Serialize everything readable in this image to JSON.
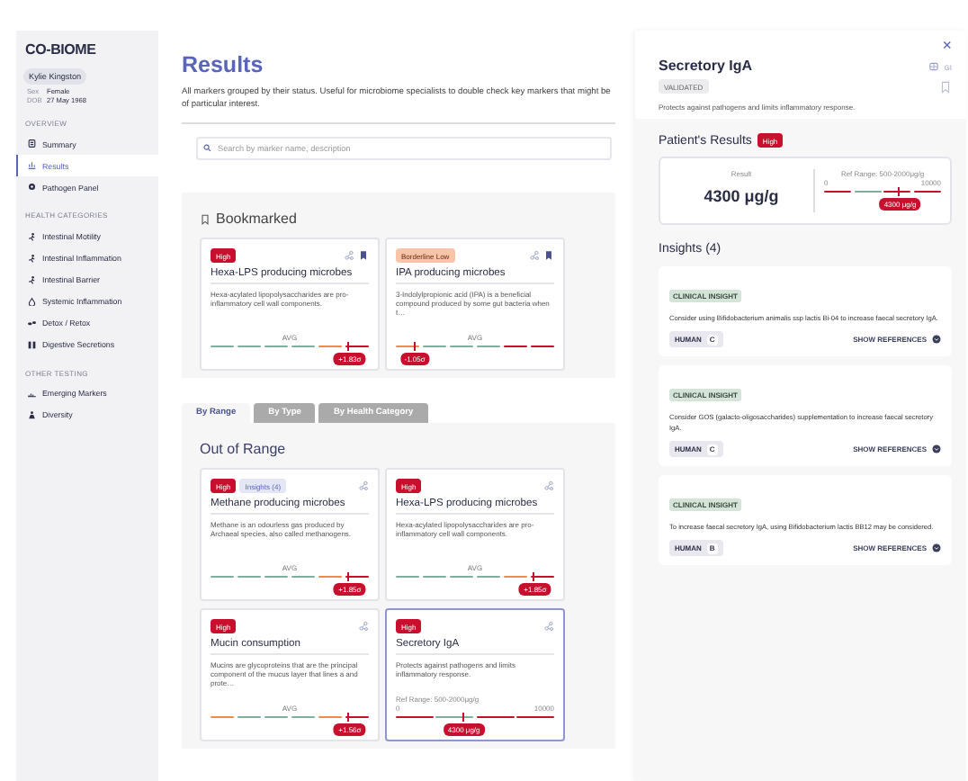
{
  "sidebar": {
    "logo": "CO-BIOME",
    "patient": {
      "name": "Kylie Kingston",
      "fields": [
        {
          "label": "Sex",
          "value": "Female"
        },
        {
          "label": "DOB",
          "value": "27 May 1968"
        }
      ]
    },
    "groups": [
      {
        "heading": "OVERVIEW",
        "items": [
          {
            "label": "Summary",
            "selected": false
          },
          {
            "label": "Results",
            "selected": true
          },
          {
            "label": "Pathogen Panel",
            "selected": false
          }
        ]
      },
      {
        "heading": "HEALTH CATEGORIES",
        "items": [
          {
            "label": "Intestinal Motility",
            "selected": false
          },
          {
            "label": "Intestinal Inflammation",
            "selected": false
          },
          {
            "label": "Intestinal Barrier",
            "selected": false
          },
          {
            "label": "Systemic Inflammation",
            "selected": false
          },
          {
            "label": "Detox / Retox",
            "selected": false
          },
          {
            "label": "Digestive Secretions",
            "selected": false
          }
        ]
      },
      {
        "heading": "OTHER TESTING",
        "items": [
          {
            "label": "Emerging Markers",
            "selected": false
          },
          {
            "label": "Diversity",
            "selected": false
          }
        ]
      }
    ]
  },
  "main": {
    "title": "Results",
    "description": "All markers grouped by their status. Useful for microbiome specialists to double check key markers that might be of particular interest.",
    "search": {
      "placeholder": "Search by marker name, description"
    },
    "sections": [
      {
        "kind": "bookmarked",
        "heading": "Bookmarked",
        "cards": [
          {
            "status": {
              "kind": "high",
              "label": "High"
            },
            "name": "Hexa-LPS producing microbes",
            "description": "Hexa-acylated lipopolysaccharides are pro-inflammatory cell wall components.",
            "bookmarked": true,
            "selected": false,
            "gauge": {
              "kind": "sigma",
              "avg": "AVG",
              "value": "+1.83σ",
              "level": 0.88,
              "bands": [
                {
                  "color": "#7fae9c"
                },
                {
                  "color": "#7fae9c"
                },
                {
                  "color": "#7fae9c"
                },
                {
                  "color": "#7fae9c"
                },
                {
                  "color": "#f08a4b"
                },
                {
                  "color": "#c8102e"
                }
              ]
            }
          },
          {
            "status": {
              "kind": "borderline",
              "label": "Borderline Low"
            },
            "name": "IPA producing microbes",
            "description": "3-Indolylpropionic acid (IPA) is a beneficial compound produced by some gut bacteria when t…",
            "bookmarked": true,
            "selected": false,
            "gauge": {
              "kind": "sigma",
              "avg": "AVG",
              "value": "-1.05σ",
              "level": 0.12,
              "bands": [
                {
                  "color": "#f08a4b"
                },
                {
                  "color": "#7fae9c"
                },
                {
                  "color": "#7fae9c"
                },
                {
                  "color": "#7fae9c"
                },
                {
                  "color": "#c8102e"
                },
                {
                  "color": "#c8102e"
                }
              ]
            }
          }
        ]
      },
      {
        "kind": "tabbed",
        "tabs": [
          {
            "label": "By Range",
            "selected": true
          },
          {
            "label": "By Type",
            "selected": false
          },
          {
            "label": "By Health Category",
            "selected": false
          }
        ],
        "heading": "Out of Range",
        "cards": [
          {
            "status": {
              "kind": "high",
              "label": "High"
            },
            "insights": "Insights (4)",
            "name": "Methane producing microbes",
            "description": "Methane is an odourless gas produced by Archaeal species, also called methanogens.",
            "bookmarked": false,
            "selected": false,
            "gauge": {
              "kind": "sigma",
              "avg": "AVG",
              "value": "+1.85σ",
              "level": 0.88,
              "bands": [
                {
                  "color": "#7fae9c"
                },
                {
                  "color": "#7fae9c"
                },
                {
                  "color": "#7fae9c"
                },
                {
                  "color": "#7fae9c"
                },
                {
                  "color": "#f08a4b"
                },
                {
                  "color": "#c8102e"
                }
              ]
            }
          },
          {
            "status": {
              "kind": "high",
              "label": "High"
            },
            "name": "Hexa-LPS producing microbes",
            "description": "Hexa-acylated lipopolysaccharides are pro-inflammatory cell wall components.",
            "bookmarked": false,
            "selected": false,
            "gauge": {
              "kind": "sigma",
              "avg": "AVG",
              "value": "+1.85σ",
              "level": 0.88,
              "bands": [
                {
                  "color": "#7fae9c"
                },
                {
                  "color": "#7fae9c"
                },
                {
                  "color": "#7fae9c"
                },
                {
                  "color": "#7fae9c"
                },
                {
                  "color": "#f08a4b"
                },
                {
                  "color": "#c8102e"
                }
              ]
            }
          },
          {
            "status": {
              "kind": "high",
              "label": "High"
            },
            "name": "Mucin consumption",
            "description": "Mucins are glycoproteins that are the principal component of the mucus layer that lines a and prote…",
            "bookmarked": false,
            "selected": false,
            "gauge": {
              "kind": "sigma",
              "avg": "AVG",
              "value": "+1.56σ",
              "level": 0.88,
              "bands": [
                {
                  "color": "#f08a4b"
                },
                {
                  "color": "#7fae9c"
                },
                {
                  "color": "#7fae9c"
                },
                {
                  "color": "#7fae9c"
                },
                {
                  "color": "#f08a4b"
                },
                {
                  "color": "#c8102e"
                }
              ]
            }
          },
          {
            "status": {
              "kind": "high",
              "label": "High"
            },
            "name": "Secretory IgA",
            "description": "Protects against pathogens and limits inflammatory response.",
            "bookmarked": false,
            "selected": true,
            "gauge": {
              "kind": "range",
              "ref": "Ref Range: 500-2000μg/g",
              "min": "0",
              "max": "10000",
              "value": "4300 μg/g",
              "level": 0.43,
              "bands": [
                {
                  "color": "#c8102e"
                },
                {
                  "color": "#7fae9c"
                },
                {
                  "color": "#c8102e"
                },
                {
                  "color": "#c8102e"
                }
              ]
            }
          }
        ]
      }
    ]
  },
  "panel": {
    "close": "×",
    "title": "Secretory IgA",
    "category": "GI",
    "tag": "VALIDATED",
    "bookmarked": false,
    "description": "Protects against pathogens and limits inflammatory response.",
    "results": {
      "heading": "Patient's Results",
      "status": {
        "kind": "high",
        "label": "High"
      },
      "result_label": "Result",
      "result": "4300 μg/g",
      "gauge": {
        "kind": "range",
        "ref": "Ref Range: 500-2000μg/g",
        "min": "0",
        "max": "10000",
        "value": "4300 μg/g",
        "level": 0.65,
        "bands": [
          {
            "color": "#c8102e"
          },
          {
            "color": "#7fae9c"
          },
          {
            "color": "#c8102e"
          },
          {
            "color": "#c8102e"
          }
        ]
      }
    },
    "insights_heading": "Insights (4)",
    "insights": [
      {
        "tag": "CLINICAL INSIGHT",
        "text": "Consider using Bifidobacterium animalis ssp lactis Bi-04 to increase faecal secretory IgA.",
        "evidence": "HUMAN",
        "grade": "C",
        "action": "SHOW REFERENCES"
      },
      {
        "tag": "CLINICAL INSIGHT",
        "text": "Consider GOS (galacto-oligosaccharides) supplementation to increase faecal secretory IgA.",
        "evidence": "HUMAN",
        "grade": "C",
        "action": "SHOW REFERENCES"
      },
      {
        "tag": "CLINICAL INSIGHT",
        "text": "To increase faecal secretory IgA, using Bifidobacterium lactis BB12 may be considered.",
        "evidence": "HUMAN",
        "grade": "B",
        "action": "SHOW REFERENCES"
      }
    ]
  }
}
